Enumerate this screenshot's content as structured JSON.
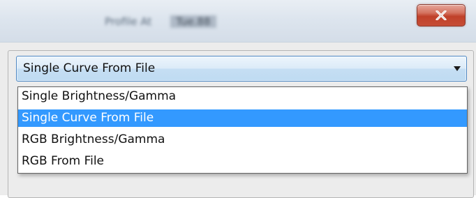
{
  "window": {
    "title_segment_1": "Profile At",
    "title_segment_2": "Tue.88"
  },
  "combo": {
    "selected_value": "Single Curve From File"
  },
  "dropdown": {
    "options": [
      "Single Brightness/Gamma",
      "Single Curve From File",
      "RGB Brightness/Gamma",
      "RGB From File"
    ],
    "selected_index": 1,
    "highlight_color": "#3399ff"
  },
  "icons": {
    "close": "close-icon",
    "dropdown_arrow": "chevron-down-icon"
  },
  "colors": {
    "close_button": "#c7432c",
    "combo_border": "#4f88c3"
  }
}
